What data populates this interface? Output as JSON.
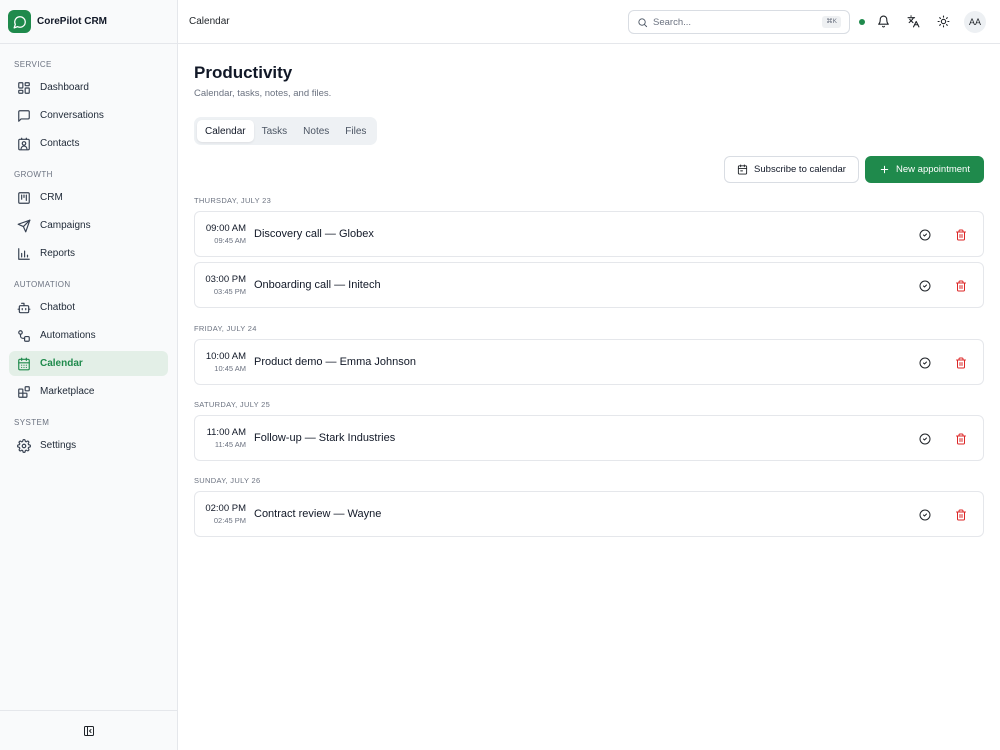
{
  "app": {
    "name": "CorePilot CRM",
    "accent": "#1f8a4c",
    "danger": "#dc2626"
  },
  "sidebar": {
    "sections": [
      {
        "label": "SERVICE",
        "items": [
          {
            "label": "Dashboard",
            "icon": "dashboard-icon"
          },
          {
            "label": "Conversations",
            "icon": "chat-icon"
          },
          {
            "label": "Contacts",
            "icon": "contact-card-icon"
          }
        ]
      },
      {
        "label": "GROWTH",
        "items": [
          {
            "label": "CRM",
            "icon": "kanban-icon"
          },
          {
            "label": "Campaigns",
            "icon": "send-icon"
          },
          {
            "label": "Reports",
            "icon": "bar-chart-icon"
          }
        ]
      },
      {
        "label": "AUTOMATION",
        "items": [
          {
            "label": "Chatbot",
            "icon": "bot-icon"
          },
          {
            "label": "Automations",
            "icon": "workflow-icon"
          },
          {
            "label": "Calendar",
            "icon": "calendar-icon",
            "active": true
          },
          {
            "label": "Marketplace",
            "icon": "blocks-icon"
          }
        ]
      },
      {
        "label": "SYSTEM",
        "items": [
          {
            "label": "Settings",
            "icon": "gear-icon"
          }
        ]
      }
    ],
    "footer_icon": "collapse-sidebar-icon"
  },
  "topbar": {
    "breadcrumb": "Calendar",
    "search": {
      "placeholder": "Search...",
      "shortcut": "⌘K"
    },
    "status": "online",
    "icons": [
      "bell-icon",
      "translate-icon",
      "sun-icon"
    ],
    "avatar": "AA"
  },
  "page": {
    "title": "Productivity",
    "subtitle": "Calendar, tasks, notes, and files.",
    "tabs": [
      {
        "label": "Calendar",
        "active": true
      },
      {
        "label": "Tasks"
      },
      {
        "label": "Notes"
      },
      {
        "label": "Files"
      }
    ],
    "actions": {
      "subscribe_label": "Subscribe to calendar",
      "new_label": "New appointment"
    }
  },
  "days": [
    {
      "label": "THURSDAY, JULY 23",
      "appointments": [
        {
          "start": "09:00 AM",
          "end": "09:45 AM",
          "title": "Discovery call — Globex"
        },
        {
          "start": "03:00 PM",
          "end": "03:45 PM",
          "title": "Onboarding call — Initech"
        }
      ]
    },
    {
      "label": "FRIDAY, JULY 24",
      "appointments": [
        {
          "start": "10:00 AM",
          "end": "10:45 AM",
          "title": "Product demo — Emma Johnson"
        }
      ]
    },
    {
      "label": "SATURDAY, JULY 25",
      "appointments": [
        {
          "start": "11:00 AM",
          "end": "11:45 AM",
          "title": "Follow-up — Stark Industries"
        }
      ]
    },
    {
      "label": "SUNDAY, JULY 26",
      "appointments": [
        {
          "start": "02:00 PM",
          "end": "02:45 PM",
          "title": "Contract review — Wayne"
        }
      ]
    }
  ]
}
